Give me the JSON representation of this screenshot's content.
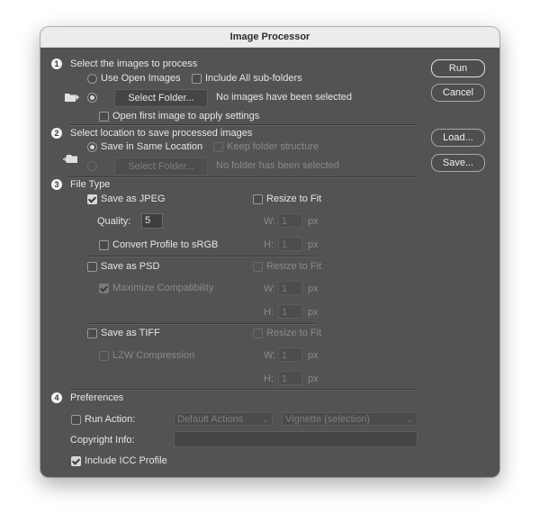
{
  "window": {
    "title": "Image Processor"
  },
  "buttons": {
    "run": "Run",
    "cancel": "Cancel",
    "load": "Load...",
    "save": "Save..."
  },
  "section1": {
    "number": "1",
    "heading": "Select the images to process",
    "use_open_images": "Use Open Images",
    "include_subfolders": "Include All sub-folders",
    "select_folder": "Select Folder...",
    "status": "No images have been selected",
    "open_first": "Open first image to apply settings"
  },
  "section2": {
    "number": "2",
    "heading": "Select location to save processed images",
    "save_same": "Save in Same Location",
    "keep_structure": "Keep folder structure",
    "select_folder": "Select Folder...",
    "status": "No folder has been selected"
  },
  "section3": {
    "number": "3",
    "heading": "File Type",
    "jpeg": {
      "save_as": "Save as JPEG",
      "resize": "Resize to Fit",
      "quality_label": "Quality:",
      "quality_value": "5",
      "convert": "Convert Profile to sRGB",
      "w_label": "W:",
      "w_value": "1",
      "w_unit": "px",
      "h_label": "H:",
      "h_value": "1",
      "h_unit": "px"
    },
    "psd": {
      "save_as": "Save as PSD",
      "resize": "Resize to Fit",
      "maximize": "Maximize Compatibility",
      "w_label": "W:",
      "w_value": "1",
      "w_unit": "px",
      "h_label": "H:",
      "h_value": "1",
      "h_unit": "px"
    },
    "tiff": {
      "save_as": "Save as TIFF",
      "resize": "Resize to Fit",
      "lzw": "LZW Compression",
      "w_label": "W:",
      "w_value": "1",
      "w_unit": "px",
      "h_label": "H:",
      "h_value": "1",
      "h_unit": "px"
    }
  },
  "section4": {
    "number": "4",
    "heading": "Preferences",
    "run_action": "Run Action:",
    "action_set": "Default Actions",
    "action": "Vignette (selection)",
    "copyright": "Copyright Info:",
    "copyright_value": "",
    "icc": "Include ICC Profile"
  },
  "icons": {
    "folder_arrow": "folder-import-icon",
    "folder_export": "folder-export-icon"
  },
  "colors": {
    "panel": "#535353",
    "titlebar": "#ececec",
    "text": "#e6e6e6",
    "disabled": "#8a8a8a"
  }
}
